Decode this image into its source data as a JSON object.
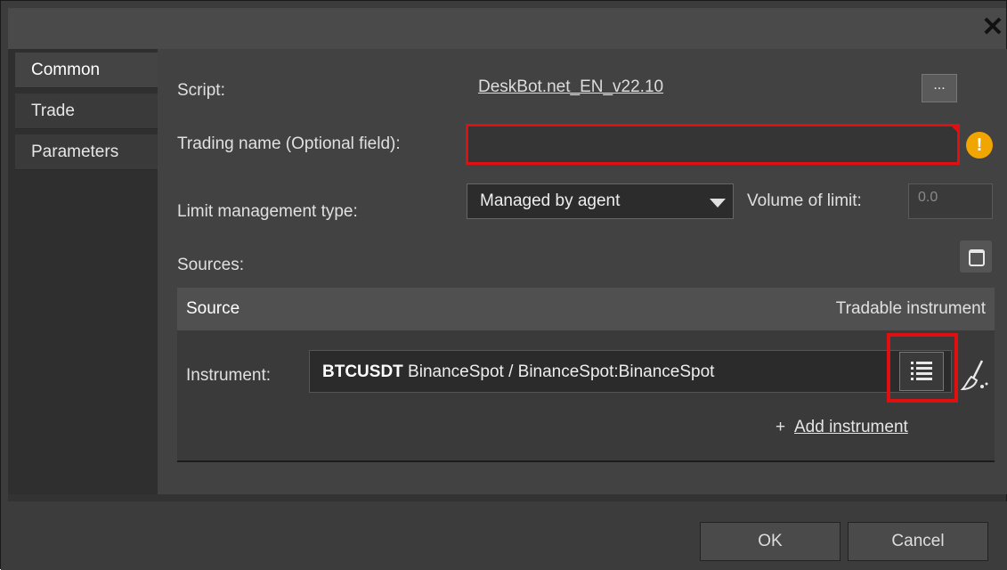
{
  "tabs": [
    {
      "label": "Common"
    },
    {
      "label": "Trade"
    },
    {
      "label": "Parameters"
    }
  ],
  "form": {
    "script_label": "Script:",
    "script_value": "DeskBot.net_EN_v22.10",
    "browse_label": "...",
    "trading_name_label": "Trading name (Optional field):",
    "trading_name_value": "",
    "info_symbol": "!",
    "limit_type_label": "Limit management type:",
    "limit_type_value": "Managed by agent",
    "volume_label": "Volume of limit:",
    "volume_value": "0.0",
    "sources_label": "Sources:"
  },
  "grid": {
    "col_source": "Source",
    "col_tradable": "Tradable instrument",
    "instrument_label": "Instrument:",
    "instrument_symbol": "BTCUSDT",
    "instrument_rest": " BinanceSpot / BinanceSpot:BinanceSpot",
    "add_prefix": "+ ",
    "add_instrument": "Add instrument"
  },
  "buttons": {
    "ok": "OK",
    "cancel": "Cancel",
    "close": "✕"
  },
  "colors": {
    "highlight": "#e01010",
    "info": "#f0a500"
  }
}
